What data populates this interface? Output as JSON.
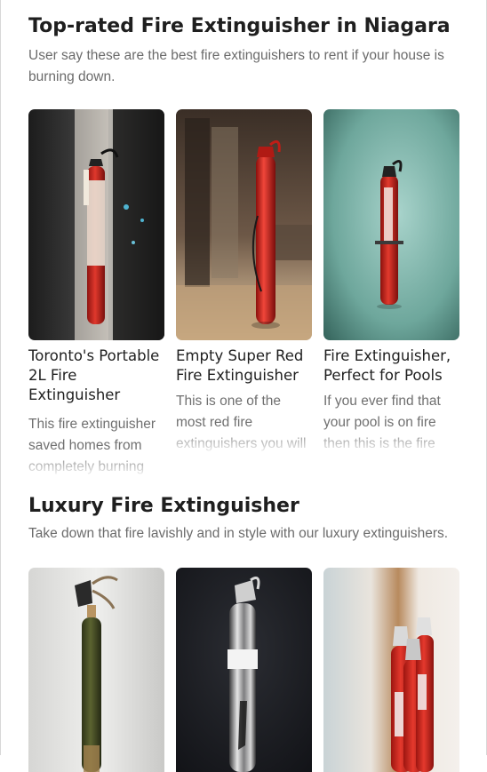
{
  "sections": [
    {
      "title": "Top-rated Fire Extinguisher in Niagara",
      "subtitle": "User say these are the best fire extinguishers to rent if your house is burning down.",
      "cards": [
        {
          "title": "Toronto's Portable 2L Fire Extinguisher",
          "description": "This fire extinguisher saved homes from completely burning",
          "image": "wall-mounted red fire extinguisher with tag, dark background"
        },
        {
          "title": "Empty Super Red Fire Extinguisher",
          "description": "This is one of the most red fire extinguishers you will ever see. Second",
          "image": "tall red fire extinguisher in a room"
        },
        {
          "title": "Fire Extinguisher, Perfect for Pools",
          "description": "If you ever find that your pool is on fire then this is the fire extinguisher for",
          "image": "red fire extinguisher on teal wall"
        }
      ]
    },
    {
      "title": "Luxury Fire Extinguisher",
      "subtitle": "Take down that fire lavishly and in style with our luxury extinguishers.",
      "cards": [
        {
          "image": "olive green luxury extinguisher on grey background"
        },
        {
          "image": "chrome silver extinguisher on dark background"
        },
        {
          "image": "row of red extinguishers against wall"
        }
      ]
    }
  ],
  "colors": {
    "heading": "#1f1f1f",
    "body_text": "#6b6b6b",
    "extinguisher_red": "#d42a22"
  }
}
